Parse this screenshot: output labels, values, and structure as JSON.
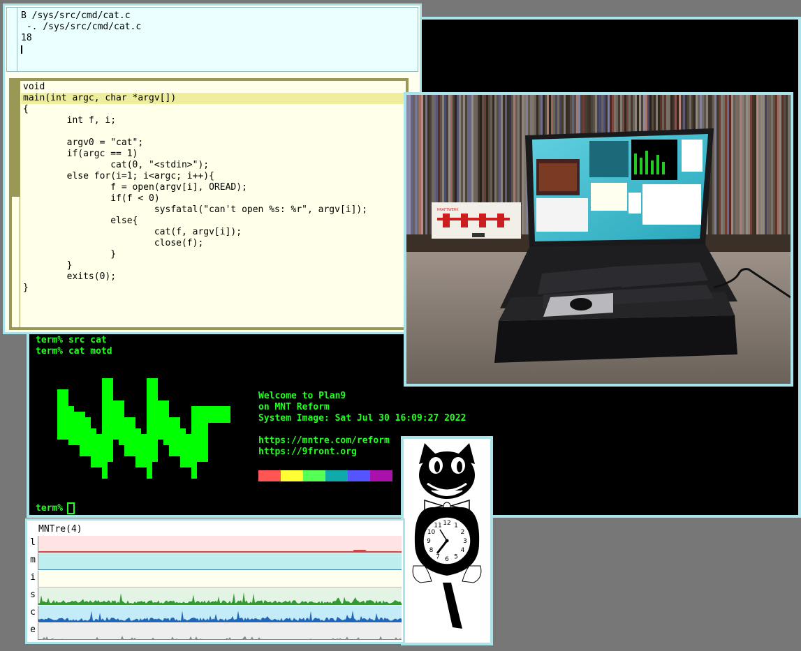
{
  "editor": {
    "tag_lines": [
      "B /sys/src/cmd/cat.c",
      " -. /sys/src/cmd/cat.c",
      "18",
      ""
    ],
    "code_lines": [
      "void",
      "main(int argc, char *argv[])",
      "{",
      "        int f, i;",
      "",
      "        argv0 = \"cat\";",
      "        if(argc == 1)",
      "                cat(0, \"<stdin>\");",
      "        else for(i=1; i<argc; i++){",
      "                f = open(argv[i], OREAD);",
      "                if(f < 0)",
      "                        sysfatal(\"can't open %s: %r\", argv[i]);",
      "                else{",
      "                        cat(f, argv[i]);",
      "                        close(f);",
      "                }",
      "        }",
      "        exits(0);",
      "}"
    ]
  },
  "terminal": {
    "lines": [
      "term% src cat",
      "term% cat motd"
    ],
    "motd_lines": [
      "Welcome to Plan9",
      "on MNT Reform",
      "System Image: Sat Jul 30 16:09:27 2022",
      "",
      "https://mntre.com/reform",
      "https://9front.org"
    ],
    "palette": [
      "#ff5555",
      "#ffff33",
      "#55ff55",
      "#11aaaa",
      "#5555ff",
      "#aa11aa"
    ],
    "prompt": "term%",
    "logo_color": "#00ff00"
  },
  "stats": {
    "title": "MNTre(4)",
    "rows": [
      {
        "label": "l",
        "bg": "#ffe4e4",
        "line": "#cc4444"
      },
      {
        "label": "m",
        "bg": "#bfeeee",
        "line": "#4488aa"
      },
      {
        "label": "i",
        "bg": "#fffff0",
        "line": "#bbbb66"
      },
      {
        "label": "s",
        "bg": "#e4f4e4",
        "line": "#339933"
      },
      {
        "label": "c",
        "bg": "#c4ecf8",
        "line": "#2266bb"
      },
      {
        "label": "e",
        "bg": "#eeeeee",
        "line": "#888888"
      }
    ]
  },
  "photo": {
    "kraftwerk_text": "KRAFTWERK"
  },
  "clock": {
    "numbers": [
      "12",
      "1",
      "2",
      "3",
      "4",
      "5",
      "6",
      "7",
      "8",
      "9",
      "10",
      "11"
    ]
  }
}
